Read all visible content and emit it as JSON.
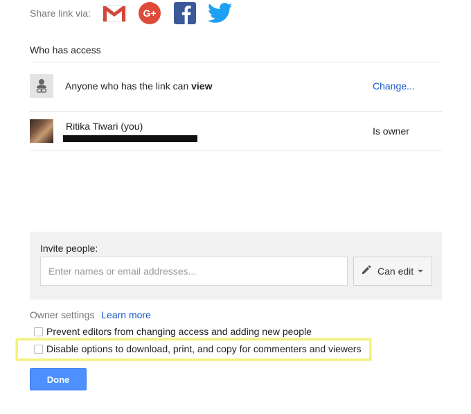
{
  "share": {
    "label": "Share link via:",
    "icons": [
      "gmail-icon",
      "google-plus-icon",
      "facebook-icon",
      "twitter-icon"
    ],
    "colors": {
      "gmail": "#d44638",
      "google_plus": "#dd4b39",
      "facebook": "#3b5998",
      "twitter": "#1da1f2"
    }
  },
  "access": {
    "title": "Who has access",
    "link_row": {
      "text_prefix": "Anyone who has the link can ",
      "text_bold": "view",
      "change_label": "Change..."
    },
    "owner_row": {
      "name": "Ritika Tiwari (you)",
      "role": "Is owner"
    }
  },
  "invite": {
    "label": "Invite people:",
    "placeholder": "Enter names or email addresses...",
    "permission_label": "Can edit"
  },
  "owner_settings": {
    "label": "Owner settings",
    "learn_more": "Learn more",
    "options": [
      {
        "label": "Prevent editors from changing access and adding new people",
        "checked": false
      },
      {
        "label": "Disable options to download, print, and copy for commenters and viewers",
        "checked": false
      }
    ]
  },
  "done_label": "Done",
  "accent_color": "#4d90fe",
  "highlight_color": "#f3f27a"
}
